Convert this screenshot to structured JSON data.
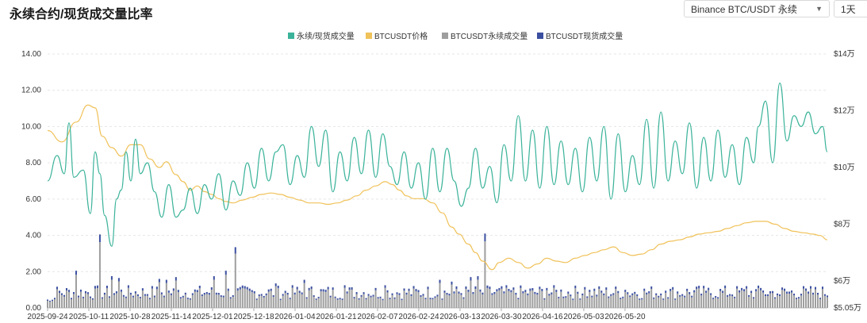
{
  "header": {
    "title": "永续合约/现货成交量比率",
    "exchange_select": "Binance BTC/USDT 永续",
    "interval_select": "1天"
  },
  "chart_data": {
    "type": "line",
    "title": "永续合约/现货成交量比率",
    "legend": [
      {
        "name": "永续/现货成交量",
        "color": "#3bb39a"
      },
      {
        "name": "BTCUSDT价格",
        "color": "#f0c25a"
      },
      {
        "name": "BTCUSDT永续成交量",
        "color": "#9e9e9e"
      },
      {
        "name": "BTCUSDT现货成交量",
        "color": "#3b4fa0"
      }
    ],
    "legend_position": "top-center",
    "x_ticks": [
      "2025-09-24",
      "2025-10-11",
      "2025-10-28",
      "2025-11-14",
      "2025-12-01",
      "2025-12-18",
      "2026-01-04",
      "2026-01-21",
      "2026-02-07",
      "2026-02-24",
      "2026-03-13",
      "2026-03-30",
      "2026-04-16",
      "2026-05-03",
      "2026-05-20"
    ],
    "y_left": {
      "ticks": [
        "0.00",
        "2.00",
        "4.00",
        "6.00",
        "8.00",
        "10.00",
        "12.00",
        "14.00"
      ],
      "range": [
        0,
        14
      ]
    },
    "y_right": {
      "ticks": [
        "$5.05万",
        "$6万",
        "$8万",
        "$10万",
        "$12万",
        "$14万"
      ],
      "values": [
        50500,
        60000,
        80000,
        100000,
        120000,
        140000
      ],
      "range": [
        50500,
        140000
      ]
    },
    "grid": "horizontal dashed",
    "ratio_series": {
      "name": "永续/现货成交量",
      "color": "#3bb39a",
      "keypoints": [
        [
          0,
          7.0
        ],
        [
          4,
          8.4
        ],
        [
          7,
          7.4
        ],
        [
          9,
          10.2
        ],
        [
          11,
          7.2
        ],
        [
          15,
          7.6
        ],
        [
          18,
          5.2
        ],
        [
          20,
          8.6
        ],
        [
          22,
          7.4
        ],
        [
          24,
          5.1
        ],
        [
          27,
          3.4
        ],
        [
          29,
          6.0
        ],
        [
          31,
          6.5
        ],
        [
          33,
          8.6
        ],
        [
          35,
          7.0
        ],
        [
          37,
          9.3
        ],
        [
          39,
          7.4
        ],
        [
          42,
          8.0
        ],
        [
          45,
          6.4
        ],
        [
          48,
          5.0
        ],
        [
          51,
          6.8
        ],
        [
          54,
          5.0
        ],
        [
          57,
          5.4
        ],
        [
          60,
          6.6
        ],
        [
          63,
          5.2
        ],
        [
          66,
          6.8
        ],
        [
          69,
          6.0
        ],
        [
          72,
          7.4
        ],
        [
          75,
          5.4
        ],
        [
          78,
          7.0
        ],
        [
          81,
          6.2
        ],
        [
          84,
          8.0
        ],
        [
          87,
          6.6
        ],
        [
          90,
          8.8
        ],
        [
          93,
          7.0
        ],
        [
          96,
          8.6
        ],
        [
          99,
          9.0
        ],
        [
          102,
          6.8
        ],
        [
          105,
          8.4
        ],
        [
          108,
          7.2
        ],
        [
          111,
          10.0
        ],
        [
          114,
          7.8
        ],
        [
          117,
          9.8
        ],
        [
          120,
          6.4
        ],
        [
          123,
          8.6
        ],
        [
          126,
          7.0
        ],
        [
          129,
          9.4
        ],
        [
          132,
          7.4
        ],
        [
          135,
          9.8
        ],
        [
          138,
          7.2
        ],
        [
          141,
          9.6
        ],
        [
          144,
          7.8
        ],
        [
          147,
          6.8
        ],
        [
          150,
          8.6
        ],
        [
          153,
          6.6
        ],
        [
          156,
          8.0
        ],
        [
          159,
          6.0
        ],
        [
          162,
          8.8
        ],
        [
          165,
          6.4
        ],
        [
          168,
          8.8
        ],
        [
          171,
          7.0
        ],
        [
          174,
          5.6
        ],
        [
          177,
          6.6
        ],
        [
          180,
          8.8
        ],
        [
          183,
          6.6
        ],
        [
          186,
          7.8
        ],
        [
          189,
          5.8
        ],
        [
          192,
          9.0
        ],
        [
          195,
          7.0
        ],
        [
          198,
          10.6
        ],
        [
          201,
          7.0
        ],
        [
          204,
          9.8
        ],
        [
          207,
          6.6
        ],
        [
          210,
          10.0
        ],
        [
          213,
          6.8
        ],
        [
          216,
          9.2
        ],
        [
          219,
          6.8
        ],
        [
          222,
          8.8
        ],
        [
          225,
          6.4
        ],
        [
          228,
          9.4
        ],
        [
          231,
          7.0
        ],
        [
          234,
          10.0
        ],
        [
          237,
          6.0
        ],
        [
          240,
          9.6
        ],
        [
          243,
          6.4
        ],
        [
          246,
          8.4
        ],
        [
          249,
          6.8
        ],
        [
          252,
          10.4
        ],
        [
          255,
          6.6
        ],
        [
          258,
          10.8
        ],
        [
          261,
          7.0
        ],
        [
          264,
          9.2
        ],
        [
          267,
          7.4
        ],
        [
          270,
          10.2
        ],
        [
          273,
          6.6
        ],
        [
          276,
          9.4
        ],
        [
          279,
          7.0
        ],
        [
          282,
          9.8
        ],
        [
          285,
          7.2
        ],
        [
          288,
          9.0
        ],
        [
          291,
          6.8
        ],
        [
          294,
          9.4
        ],
        [
          297,
          8.0
        ],
        [
          299,
          10.0
        ],
        [
          302,
          11.4
        ],
        [
          305,
          8.0
        ],
        [
          308,
          12.4
        ],
        [
          311,
          9.2
        ],
        [
          314,
          10.6
        ],
        [
          317,
          10.0
        ],
        [
          320,
          10.8
        ],
        [
          323,
          9.6
        ],
        [
          326,
          10.0
        ],
        [
          328,
          8.6
        ]
      ]
    },
    "price_series": {
      "name": "BTCUSDT价格",
      "color": "#f0c25a",
      "keypoints": [
        [
          0,
          113000
        ],
        [
          6,
          109000
        ],
        [
          12,
          116000
        ],
        [
          17,
          122000
        ],
        [
          20,
          121000
        ],
        [
          23,
          111000
        ],
        [
          27,
          107000
        ],
        [
          31,
          104000
        ],
        [
          35,
          108000
        ],
        [
          39,
          108000
        ],
        [
          43,
          103000
        ],
        [
          47,
          100000
        ],
        [
          50,
          102000
        ],
        [
          54,
          97500
        ],
        [
          57,
          95000
        ],
        [
          60,
          92000
        ],
        [
          63,
          93500
        ],
        [
          66,
          91500
        ],
        [
          69,
          90500
        ],
        [
          72,
          89000
        ],
        [
          75,
          88000
        ],
        [
          78,
          87500
        ],
        [
          82,
          88500
        ],
        [
          86,
          89500
        ],
        [
          90,
          90500
        ],
        [
          94,
          91000
        ],
        [
          98,
          90500
        ],
        [
          102,
          89500
        ],
        [
          106,
          88500
        ],
        [
          110,
          87500
        ],
        [
          114,
          87500
        ],
        [
          118,
          87000
        ],
        [
          122,
          87500
        ],
        [
          126,
          88500
        ],
        [
          130,
          90000
        ],
        [
          134,
          92000
        ],
        [
          138,
          93500
        ],
        [
          142,
          95000
        ],
        [
          145,
          94000
        ],
        [
          148,
          92000
        ],
        [
          151,
          90000
        ],
        [
          154,
          89000
        ],
        [
          158,
          89000
        ],
        [
          162,
          87500
        ],
        [
          166,
          84000
        ],
        [
          170,
          79000
        ],
        [
          173,
          76500
        ],
        [
          177,
          73000
        ],
        [
          180,
          70000
        ],
        [
          183,
          67000
        ],
        [
          187,
          64000
        ],
        [
          190,
          66500
        ],
        [
          194,
          68000
        ],
        [
          198,
          66500
        ],
        [
          202,
          64500
        ],
        [
          206,
          66000
        ],
        [
          210,
          68000
        ],
        [
          214,
          67000
        ],
        [
          218,
          66500
        ],
        [
          222,
          68000
        ],
        [
          226,
          69000
        ],
        [
          230,
          70000
        ],
        [
          234,
          71000
        ],
        [
          238,
          72000
        ],
        [
          242,
          70000
        ],
        [
          246,
          69000
        ],
        [
          250,
          69500
        ],
        [
          254,
          71000
        ],
        [
          258,
          73000
        ],
        [
          262,
          74000
        ],
        [
          266,
          74500
        ],
        [
          270,
          75500
        ],
        [
          274,
          76500
        ],
        [
          278,
          77000
        ],
        [
          282,
          77500
        ],
        [
          286,
          78500
        ],
        [
          290,
          79500
        ],
        [
          294,
          80500
        ],
        [
          298,
          81000
        ],
        [
          302,
          81000
        ],
        [
          306,
          80000
        ],
        [
          310,
          78500
        ],
        [
          314,
          77500
        ],
        [
          318,
          77000
        ],
        [
          322,
          76500
        ],
        [
          325,
          76000
        ],
        [
          328,
          74500
        ]
      ]
    },
    "volume_series_note": "Stacked bars (perpetual + spot) drawn on left axis scale; bar heights read approximately.",
    "perp_volume": {
      "name": "BTCUSDT永续成交量",
      "color": "#9e9e9e",
      "spikes": [
        [
          12,
          2.05
        ],
        [
          22,
          4.05
        ],
        [
          27,
          1.75
        ],
        [
          30,
          1.65
        ],
        [
          47,
          1.6
        ],
        [
          50,
          1.55
        ],
        [
          54,
          1.7
        ],
        [
          70,
          1.75
        ],
        [
          75,
          2.05
        ],
        [
          79,
          3.35
        ],
        [
          96,
          1.35
        ],
        [
          108,
          1.55
        ],
        [
          125,
          1.25
        ],
        [
          142,
          1.25
        ],
        [
          165,
          1.55
        ],
        [
          170,
          1.45
        ],
        [
          178,
          1.7
        ],
        [
          181,
          1.75
        ],
        [
          184,
          4.1
        ],
        [
          194,
          1.05
        ],
        [
          210,
          1.1
        ],
        [
          226,
          1.15
        ],
        [
          243,
          1.0
        ],
        [
          260,
          0.95
        ],
        [
          277,
          0.95
        ],
        [
          294,
          1.2
        ],
        [
          300,
          1.1
        ],
        [
          308,
          0.75
        ],
        [
          320,
          0.9
        ]
      ],
      "baseline": 0.9
    },
    "spot_volume": {
      "name": "BTCUSDT现货成交量",
      "color": "#3b4fa0",
      "fraction": 0.1
    }
  }
}
